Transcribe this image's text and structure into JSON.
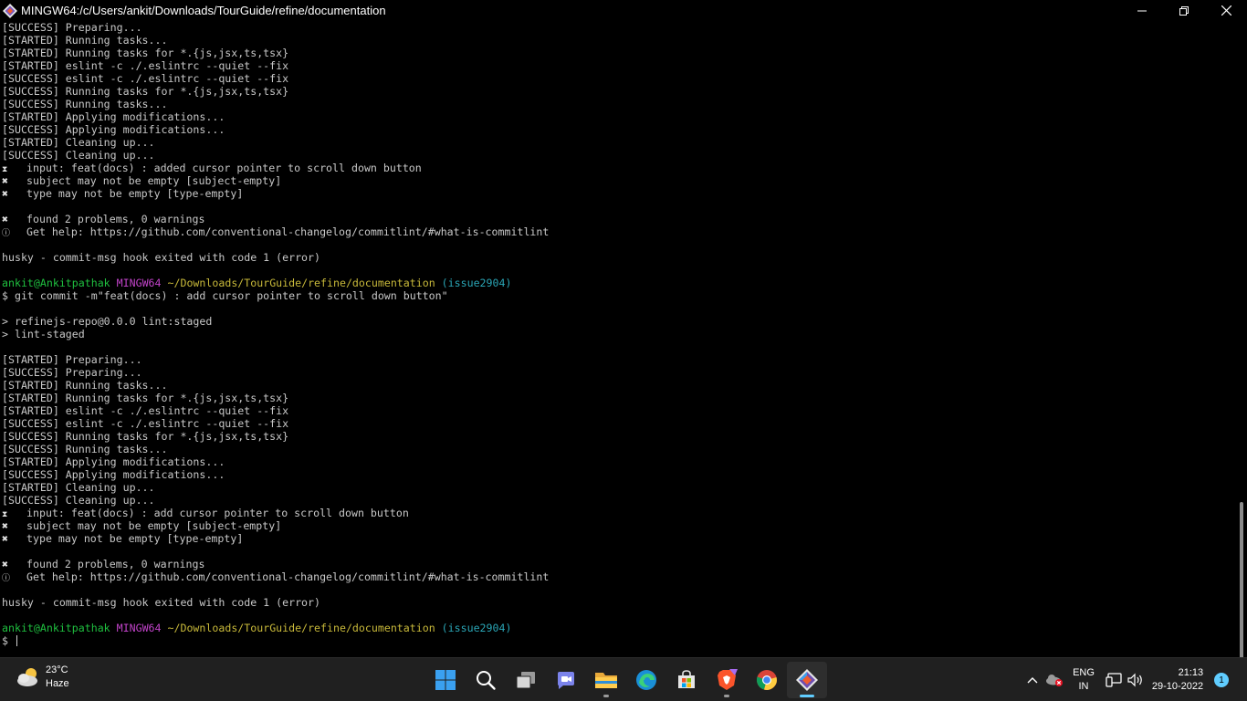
{
  "window": {
    "title": "MINGW64:/c/Users/ankit/Downloads/TourGuide/refine/documentation"
  },
  "terminal": {
    "lines": [
      {
        "segs": [
          {
            "t": "[SUCCESS] Preparing..."
          }
        ]
      },
      {
        "segs": [
          {
            "t": "[STARTED] Running tasks..."
          }
        ]
      },
      {
        "segs": [
          {
            "t": "[STARTED] Running tasks for *.{js,jsx,ts,tsx}"
          }
        ]
      },
      {
        "segs": [
          {
            "t": "[STARTED] eslint -c ./.eslintrc --quiet --fix"
          }
        ]
      },
      {
        "segs": [
          {
            "t": "[SUCCESS] eslint -c ./.eslintrc --quiet --fix"
          }
        ]
      },
      {
        "segs": [
          {
            "t": "[SUCCESS] Running tasks for *.{js,jsx,ts,tsx}"
          }
        ]
      },
      {
        "segs": [
          {
            "t": "[SUCCESS] Running tasks..."
          }
        ]
      },
      {
        "segs": [
          {
            "t": "[STARTED] Applying modifications..."
          }
        ]
      },
      {
        "segs": [
          {
            "t": "[SUCCESS] Applying modifications..."
          }
        ]
      },
      {
        "segs": [
          {
            "t": "[STARTED] Cleaning up..."
          }
        ]
      },
      {
        "segs": [
          {
            "t": "[SUCCESS] Cleaning up..."
          }
        ]
      },
      {
        "mark": "⧗",
        "small": true,
        "segs": [
          {
            "t": "input: feat(docs) : added cursor pointer to scroll down button"
          }
        ]
      },
      {
        "mark": "✖",
        "segs": [
          {
            "t": "subject may not be empty [subject-empty]"
          }
        ]
      },
      {
        "mark": "✖",
        "segs": [
          {
            "t": "type may not be empty [type-empty]"
          }
        ]
      },
      {
        "segs": [
          {
            "t": ""
          }
        ]
      },
      {
        "mark": "✖",
        "segs": [
          {
            "t": "found 2 problems, 0 warnings"
          }
        ]
      },
      {
        "mark": "ⓘ",
        "small": true,
        "segs": [
          {
            "t": "Get help: https://github.com/conventional-changelog/commitlint/#what-is-commitlint"
          }
        ]
      },
      {
        "segs": [
          {
            "t": ""
          }
        ]
      },
      {
        "segs": [
          {
            "t": "husky - commit-msg hook exited with code 1 (error)"
          }
        ]
      },
      {
        "segs": [
          {
            "t": ""
          }
        ]
      },
      {
        "segs": [
          {
            "t": "ankit@Ankitpathak",
            "c": "c-green"
          },
          {
            "t": " "
          },
          {
            "t": "MINGW64",
            "c": "c-magenta"
          },
          {
            "t": " "
          },
          {
            "t": "~/Downloads/TourGuide/refine/documentation",
            "c": "c-yellow"
          },
          {
            "t": " "
          },
          {
            "t": "(issue2904)",
            "c": "c-cyan"
          }
        ]
      },
      {
        "segs": [
          {
            "t": "$ git commit -m\"feat(docs) : add cursor pointer to scroll down button\""
          }
        ]
      },
      {
        "segs": [
          {
            "t": ""
          }
        ]
      },
      {
        "segs": [
          {
            "t": "> refinejs-repo@0.0.0 lint:staged"
          }
        ]
      },
      {
        "segs": [
          {
            "t": "> lint-staged"
          }
        ]
      },
      {
        "segs": [
          {
            "t": ""
          }
        ]
      },
      {
        "segs": [
          {
            "t": "[STARTED] Preparing..."
          }
        ]
      },
      {
        "segs": [
          {
            "t": "[SUCCESS] Preparing..."
          }
        ]
      },
      {
        "segs": [
          {
            "t": "[STARTED] Running tasks..."
          }
        ]
      },
      {
        "segs": [
          {
            "t": "[STARTED] Running tasks for *.{js,jsx,ts,tsx}"
          }
        ]
      },
      {
        "segs": [
          {
            "t": "[STARTED] eslint -c ./.eslintrc --quiet --fix"
          }
        ]
      },
      {
        "segs": [
          {
            "t": "[SUCCESS] eslint -c ./.eslintrc --quiet --fix"
          }
        ]
      },
      {
        "segs": [
          {
            "t": "[SUCCESS] Running tasks for *.{js,jsx,ts,tsx}"
          }
        ]
      },
      {
        "segs": [
          {
            "t": "[SUCCESS] Running tasks..."
          }
        ]
      },
      {
        "segs": [
          {
            "t": "[STARTED] Applying modifications..."
          }
        ]
      },
      {
        "segs": [
          {
            "t": "[SUCCESS] Applying modifications..."
          }
        ]
      },
      {
        "segs": [
          {
            "t": "[STARTED] Cleaning up..."
          }
        ]
      },
      {
        "segs": [
          {
            "t": "[SUCCESS] Cleaning up..."
          }
        ]
      },
      {
        "mark": "⧗",
        "small": true,
        "segs": [
          {
            "t": "input: feat(docs) : add cursor pointer to scroll down button"
          }
        ]
      },
      {
        "mark": "✖",
        "segs": [
          {
            "t": "subject may not be empty [subject-empty]"
          }
        ]
      },
      {
        "mark": "✖",
        "segs": [
          {
            "t": "type may not be empty [type-empty]"
          }
        ]
      },
      {
        "segs": [
          {
            "t": ""
          }
        ]
      },
      {
        "mark": "✖",
        "segs": [
          {
            "t": "found 2 problems, 0 warnings"
          }
        ]
      },
      {
        "mark": "ⓘ",
        "small": true,
        "segs": [
          {
            "t": "Get help: https://github.com/conventional-changelog/commitlint/#what-is-commitlint"
          }
        ]
      },
      {
        "segs": [
          {
            "t": ""
          }
        ]
      },
      {
        "segs": [
          {
            "t": "husky - commit-msg hook exited with code 1 (error)"
          }
        ]
      },
      {
        "segs": [
          {
            "t": ""
          }
        ]
      },
      {
        "segs": [
          {
            "t": "ankit@Ankitpathak",
            "c": "c-green"
          },
          {
            "t": " "
          },
          {
            "t": "MINGW64",
            "c": "c-magenta"
          },
          {
            "t": " "
          },
          {
            "t": "~/Downloads/TourGuide/refine/documentation",
            "c": "c-yellow"
          },
          {
            "t": " "
          },
          {
            "t": "(issue2904)",
            "c": "c-cyan"
          }
        ]
      },
      {
        "prompt": true,
        "segs": [
          {
            "t": "$ "
          }
        ]
      }
    ]
  },
  "taskbar": {
    "weather": {
      "temp": "23°C",
      "condition": "Haze"
    },
    "apps": [
      {
        "name": "start-button",
        "icon": "windows-logo-icon"
      },
      {
        "name": "search-button",
        "icon": "search-icon"
      },
      {
        "name": "task-view-button",
        "icon": "task-view-icon"
      },
      {
        "name": "teams-chat-button",
        "icon": "teams-chat-icon"
      },
      {
        "name": "file-explorer-button",
        "icon": "folder-icon",
        "running": true
      },
      {
        "name": "edge-button",
        "icon": "edge-icon"
      },
      {
        "name": "microsoft-store-button",
        "icon": "store-icon"
      },
      {
        "name": "brave-button",
        "icon": "brave-icon",
        "running": true
      },
      {
        "name": "chrome-button",
        "icon": "chrome-icon"
      },
      {
        "name": "git-bash-button",
        "icon": "git-bash-icon",
        "running": true,
        "active": true
      }
    ],
    "tray": {
      "lang_top": "ENG",
      "lang_bottom": "IN",
      "time": "21:13",
      "date": "29-10-2022",
      "notification_count": "1"
    }
  },
  "colors": {
    "terminal_bg": "#000000",
    "taskbar_bg": "#202020",
    "accent": "#60cdff"
  }
}
